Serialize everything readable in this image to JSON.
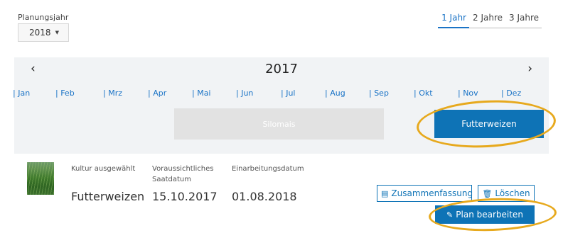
{
  "planning_year": {
    "label": "Planungsjahr",
    "selected": "2018"
  },
  "range_tabs": [
    {
      "label": "1 Jahr",
      "active": true
    },
    {
      "label": "2 Jahre",
      "active": false
    },
    {
      "label": "3 Jahre",
      "active": false
    }
  ],
  "timeline": {
    "year": "2017",
    "prev_symbol": "‹",
    "next_symbol": "›",
    "months": [
      "| Jan",
      "| Feb",
      "| Mrz",
      "| Apr",
      "| Mai",
      "| Jun",
      "| Jul",
      "| Aug",
      "| Sep",
      "| Okt",
      "| Nov",
      "| Dez"
    ],
    "bars": [
      {
        "label": "Silomais",
        "selected": false
      },
      {
        "label": "Futterweizen",
        "selected": true
      }
    ]
  },
  "detail": {
    "columns": [
      {
        "label": "Kultur ausgewählt",
        "value": "Futterweizen"
      },
      {
        "label": "Voraussichtliches Saatdatum",
        "value": "15.10.2017"
      },
      {
        "label": "Einarbeitungsdatum",
        "value": "01.08.2018"
      }
    ],
    "buttons": {
      "summary": "Zusammenfassung",
      "delete": "Löschen",
      "edit": "Plan bearbeiten"
    }
  },
  "colors": {
    "accent": "#0e73b6",
    "highlight_ring": "#e7a91d",
    "timeline_bg": "#f1f3f5",
    "inactive_bar": "#e2e2e2"
  },
  "icons": {
    "summary": "document-icon",
    "delete": "trash-icon",
    "edit": "pencil-icon"
  }
}
